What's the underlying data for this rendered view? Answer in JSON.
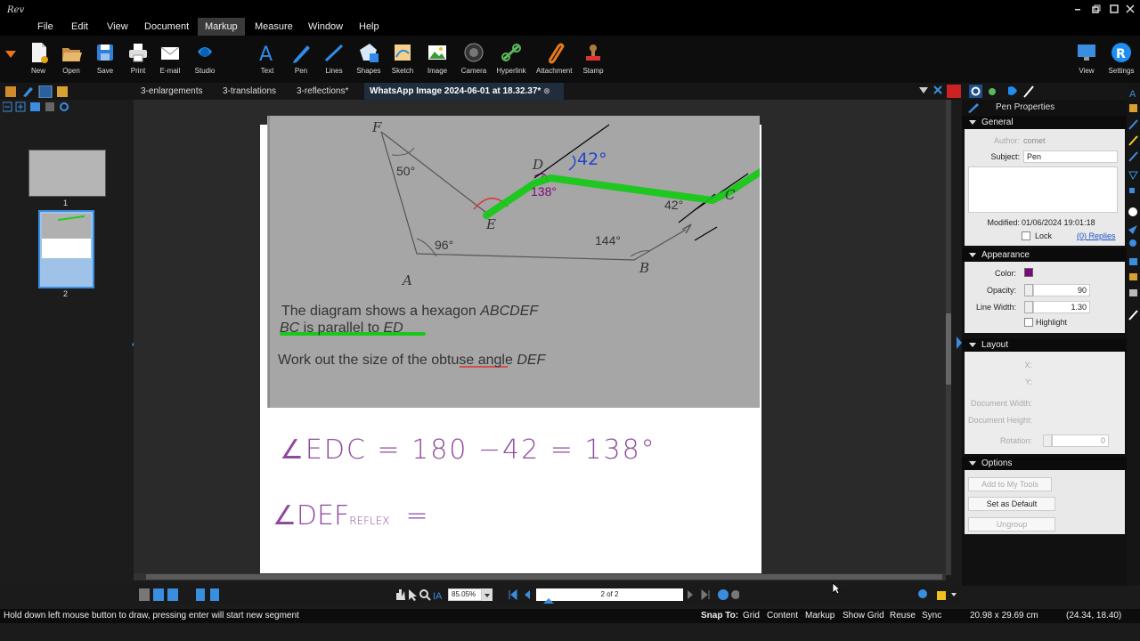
{
  "menu": {
    "items": [
      "File",
      "Edit",
      "View",
      "Document",
      "Markup",
      "Measure",
      "Window",
      "Help"
    ],
    "active": "Markup"
  },
  "ribbon": {
    "left": [
      "New",
      "Open",
      "Save",
      "Print",
      "E-mail",
      "Studio"
    ],
    "markup": [
      "Text",
      "Pen",
      "Lines",
      "Shapes",
      "Sketch",
      "Image",
      "Camera",
      "Hyperlink",
      "Attachment",
      "Stamp"
    ],
    "right": [
      "View",
      "Settings"
    ]
  },
  "tabs": [
    "3-enlargements",
    "3-translations",
    "3-reflections*",
    "WhatsApp Image 2024-06-01 at 18.32.37*"
  ],
  "thumbnails": [
    "1",
    "2"
  ],
  "page": {
    "labels": {
      "F": "F",
      "D": "D",
      "C": "C",
      "E": "E",
      "A": "A",
      "B": "B"
    },
    "angles": {
      "f": "50°",
      "a": "96°",
      "b": "144°",
      "c": "42°"
    },
    "ink_42": "42°",
    "ink_138": "138°",
    "q1a": "The diagram shows a hexagon ",
    "q1b": "ABCDEF",
    "q2a": "BC",
    "q2b": " is parallel to ",
    "q2c": "ED",
    "q3a": "Work out the size of the ",
    "q3b": "obtuse",
    "q3c": " angle ",
    "q3d": "DEF",
    "line1": "∠EDC = 180 −42 = 138°",
    "line2": "∠DEF",
    "line2sub": "REFLEX",
    "line2eq": "="
  },
  "nav": {
    "zoom": "85.05%",
    "pagebox": "2 of 2"
  },
  "status": {
    "hint": "Hold down left mouse button to draw, pressing enter will start new segment",
    "snap_to": "Snap To:",
    "snap_items": [
      "Grid",
      "Content",
      "Markup",
      "Show Grid",
      "Reuse",
      "Sync"
    ],
    "size": "20.98 x 29.69 cm",
    "coords": "(24.34, 18.40)"
  },
  "properties": {
    "title": "Pen Properties",
    "general": "General",
    "author_label": "Author:",
    "author": "comet",
    "subject_label": "Subject:",
    "subject": "Pen",
    "modified_label": "Modified:",
    "modified": "01/06/2024 19:01:18",
    "lock": "Lock",
    "replies": "(0) Replies",
    "appearance": "Appearance",
    "color_label": "Color:",
    "color": "#7a0a7a",
    "opacity_label": "Opacity:",
    "opacity": "90",
    "linewidth_label": "Line Width:",
    "linewidth": "1.30",
    "highlight": "Highlight",
    "layout": "Layout",
    "x_label": "X:",
    "y_label": "Y:",
    "docw_label": "Document Width:",
    "doch_label": "Document Height:",
    "rot_label": "Rotation:",
    "rotation": "0",
    "options": "Options",
    "add_tools": "Add to My Tools",
    "set_default": "Set as Default",
    "ungroup": "Ungroup"
  }
}
